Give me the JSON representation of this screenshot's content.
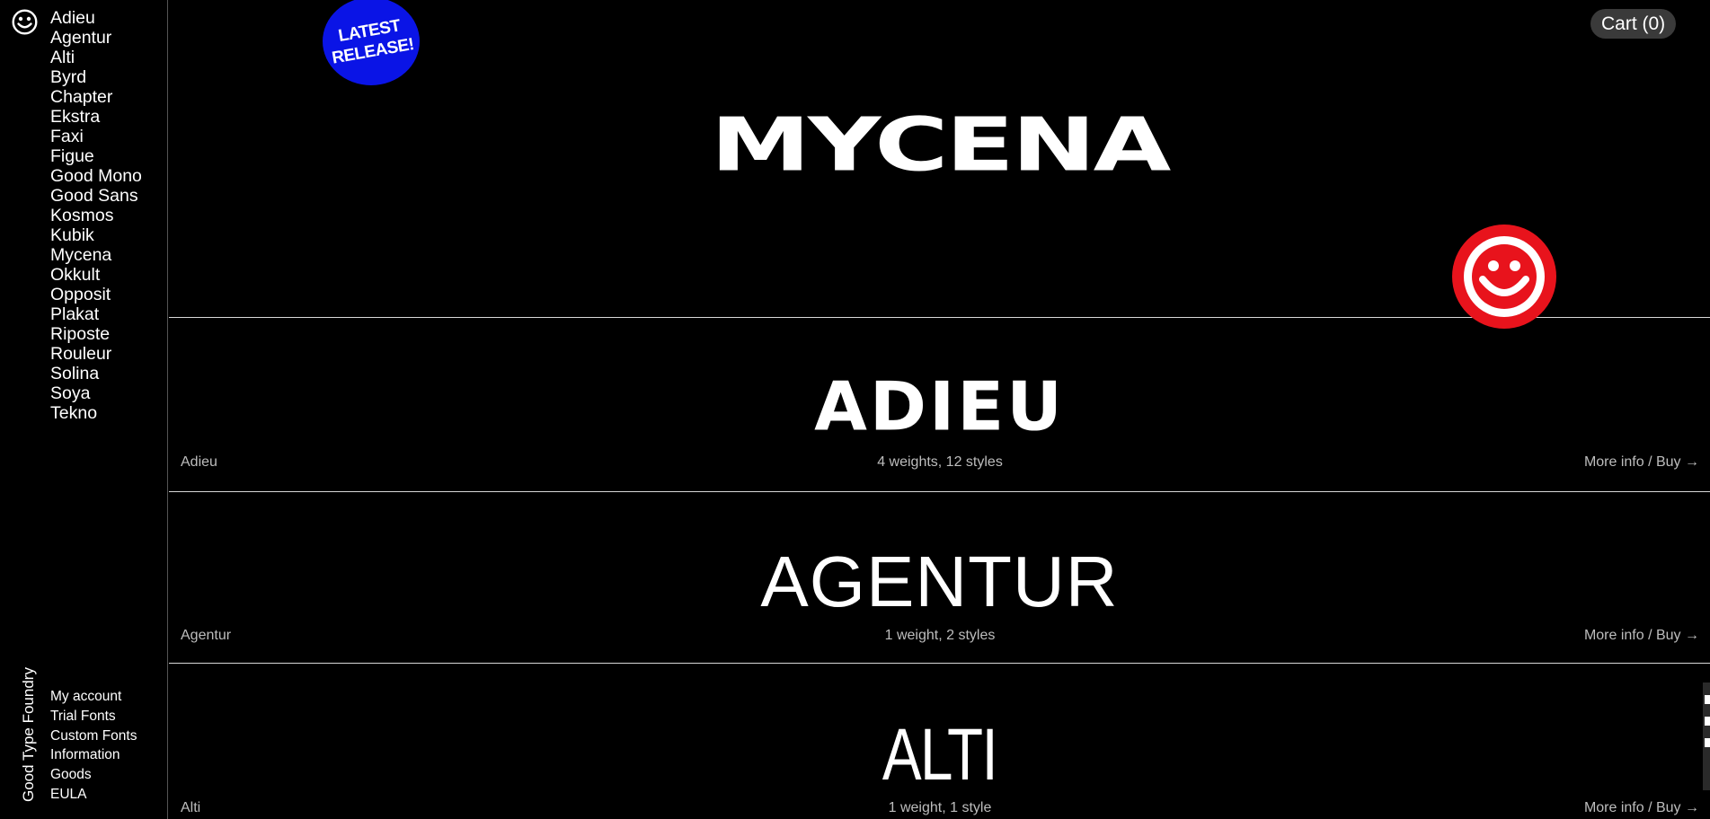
{
  "sidebar": {
    "logo_icon": "smiley-icon",
    "fonts": [
      "Adieu",
      "Agentur",
      "Alti",
      "Byrd",
      "Chapter",
      "Ekstra",
      "Faxi",
      "Figue",
      "Good Mono",
      "Good Sans",
      "Kosmos",
      "Kubik",
      "Mycena",
      "Okkult",
      "Opposit",
      "Plakat",
      "Riposte",
      "Rouleur",
      "Solina",
      "Soya",
      "Tekno"
    ],
    "brand": "Good Type Foundry",
    "links": [
      "My account",
      "Trial Fonts",
      "Custom Fonts",
      "Information",
      "Goods",
      "EULA"
    ]
  },
  "hero": {
    "badge": "LATEST\nRELEASE!",
    "badge_color": "#0a14e6",
    "title": "MYCENA",
    "smiley_icon": "smiley-badge-icon",
    "smiley_color": "#e8131c"
  },
  "header": {
    "cart_label": "Cart (0)"
  },
  "rows": [
    {
      "specimen": "ADIEU",
      "name": "Adieu",
      "styles": "4 weights, 12 styles",
      "more": "More info / Buy →"
    },
    {
      "specimen": "AGENTUR",
      "name": "Agentur",
      "styles": "1 weight, 2 styles",
      "more": "More info / Buy →"
    },
    {
      "specimen": "ALTI",
      "name": "Alti",
      "styles": "1 weight, 1 style",
      "more": "More info / Buy →"
    }
  ]
}
